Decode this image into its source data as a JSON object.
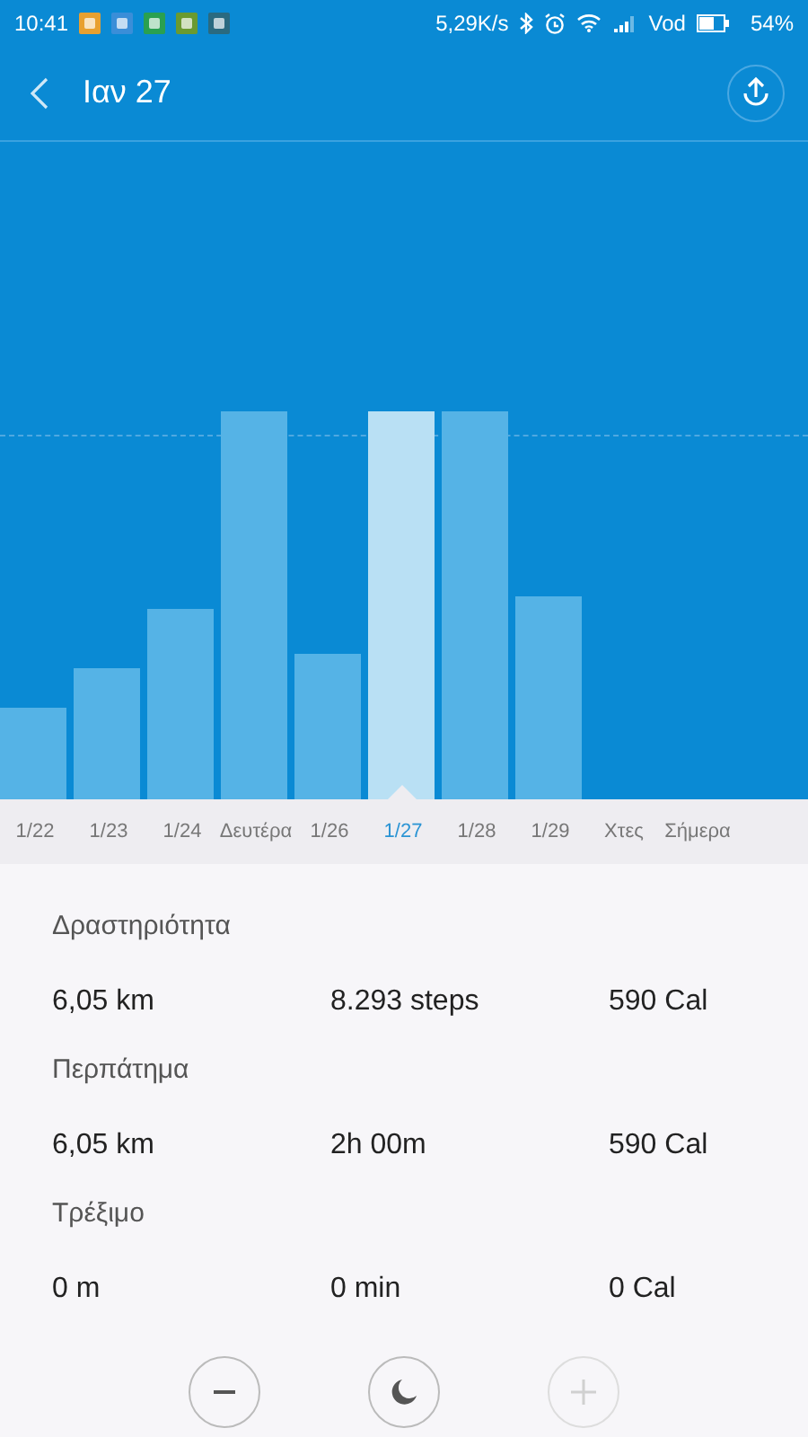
{
  "status_bar": {
    "time": "10:41",
    "speed": "5,29K/s",
    "carrier": "Vod",
    "battery": "54%"
  },
  "header": {
    "title": "Ιαν 27"
  },
  "days": [
    {
      "label": "1/22",
      "selected": false
    },
    {
      "label": "1/23",
      "selected": false
    },
    {
      "label": "1/24",
      "selected": false
    },
    {
      "label": "Δευτέρα",
      "selected": false
    },
    {
      "label": "1/26",
      "selected": false
    },
    {
      "label": "1/27",
      "selected": true
    },
    {
      "label": "1/28",
      "selected": false
    },
    {
      "label": "1/29",
      "selected": false
    },
    {
      "label": "Χτες",
      "selected": false
    },
    {
      "label": "Σήμερα",
      "selected": false
    }
  ],
  "sections": [
    {
      "title": "Δραστηριότητα",
      "values": [
        "6,05 km",
        "8.293 steps",
        "590 Cal"
      ]
    },
    {
      "title": "Περπάτημα",
      "values": [
        "6,05 km",
        "2h 00m",
        "590 Cal"
      ]
    },
    {
      "title": "Τρέξιμο",
      "values": [
        "0 m",
        "0 min",
        "0 Cal"
      ]
    }
  ],
  "controls": [
    {
      "kind": "minus",
      "disabled": false
    },
    {
      "kind": "moon",
      "disabled": false
    },
    {
      "kind": "plus",
      "disabled": true
    }
  ]
}
